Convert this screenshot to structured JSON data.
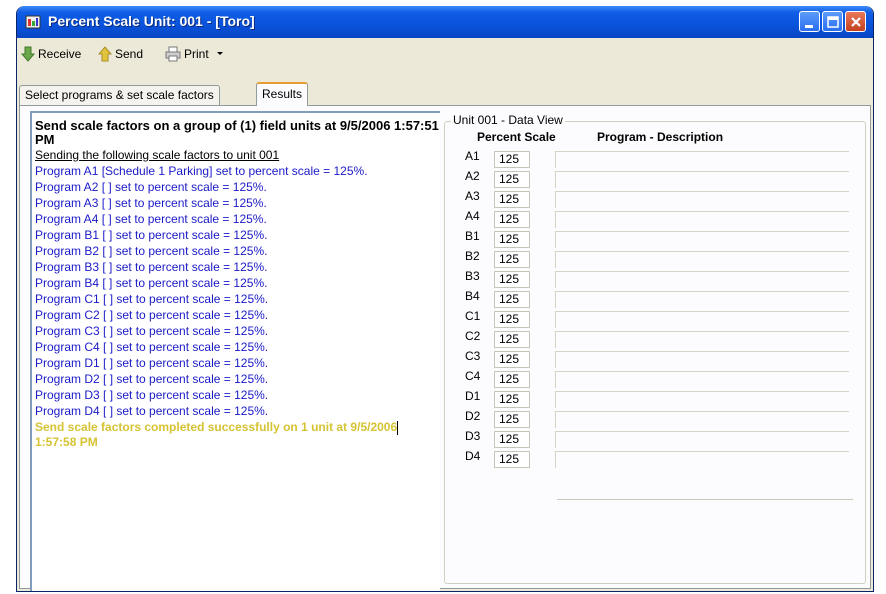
{
  "window": {
    "title": "Percent Scale Unit: 001 - [Toro]"
  },
  "toolbar": {
    "receive_label": "Receive",
    "send_label": "Send",
    "print_label": "Print"
  },
  "tabs": [
    {
      "label": "Select programs & set scale factors"
    },
    {
      "label": "Results"
    }
  ],
  "log": {
    "header": "Send scale factors on a group of (1) field units at 9/5/2006 1:57:51 PM",
    "subheader": "Sending the following scale factors to unit 001",
    "lines": [
      "Program A1 [Schedule 1 Parking] set to percent scale = 125%.",
      "Program A2 [ ] set to percent scale = 125%.",
      "Program A3 [ ] set to percent scale = 125%.",
      "Program A4 [ ] set to percent scale = 125%.",
      "Program B1 [ ] set to percent scale = 125%.",
      "Program B2 [ ] set to percent scale = 125%.",
      "Program B3 [ ] set to percent scale = 125%.",
      "Program B4 [ ] set to percent scale = 125%.",
      "Program C1 [ ] set to percent scale = 125%.",
      "Program C2 [ ] set to percent scale = 125%.",
      "Program C3 [ ] set to percent scale = 125%.",
      "Program C4 [ ] set to percent scale = 125%.",
      "Program D1 [ ] set to percent scale = 125%.",
      "Program D2 [ ] set to percent scale = 125%.",
      "Program D3 [ ] set to percent scale = 125%.",
      "Program D4 [ ] set to percent scale = 125%."
    ],
    "completed_part1": "Send scale factors completed successfully on 1 unit at 9/5/2006",
    "completed_part2": " 1:57:58 PM"
  },
  "data_view": {
    "caption": "Unit 001 - Data View",
    "col_percent": "Percent Scale",
    "col_program": "Program - Description",
    "rows": [
      {
        "label": "A1",
        "value": "125"
      },
      {
        "label": "A2",
        "value": "125"
      },
      {
        "label": "A3",
        "value": "125"
      },
      {
        "label": "A4",
        "value": "125"
      },
      {
        "label": "B1",
        "value": "125"
      },
      {
        "label": "B2",
        "value": "125"
      },
      {
        "label": "B3",
        "value": "125"
      },
      {
        "label": "B4",
        "value": "125"
      },
      {
        "label": "C1",
        "value": "125"
      },
      {
        "label": "C2",
        "value": "125"
      },
      {
        "label": "C3",
        "value": "125"
      },
      {
        "label": "C4",
        "value": "125"
      },
      {
        "label": "D1",
        "value": "125"
      },
      {
        "label": "D2",
        "value": "125"
      },
      {
        "label": "D3",
        "value": "125"
      },
      {
        "label": "D4",
        "value": "125"
      }
    ]
  },
  "colors": {
    "log_text": "#1a1ac8",
    "completed_text": "#d6c334",
    "titlebar": "#0a52db"
  },
  "icons": {
    "app": "app-icon",
    "receive": "arrow-down-icon",
    "send": "arrow-up-icon",
    "print": "printer-icon",
    "dropdown": "chevron-down-icon",
    "minimize": "minimize-icon",
    "maximize": "maximize-icon",
    "close": "close-icon"
  }
}
